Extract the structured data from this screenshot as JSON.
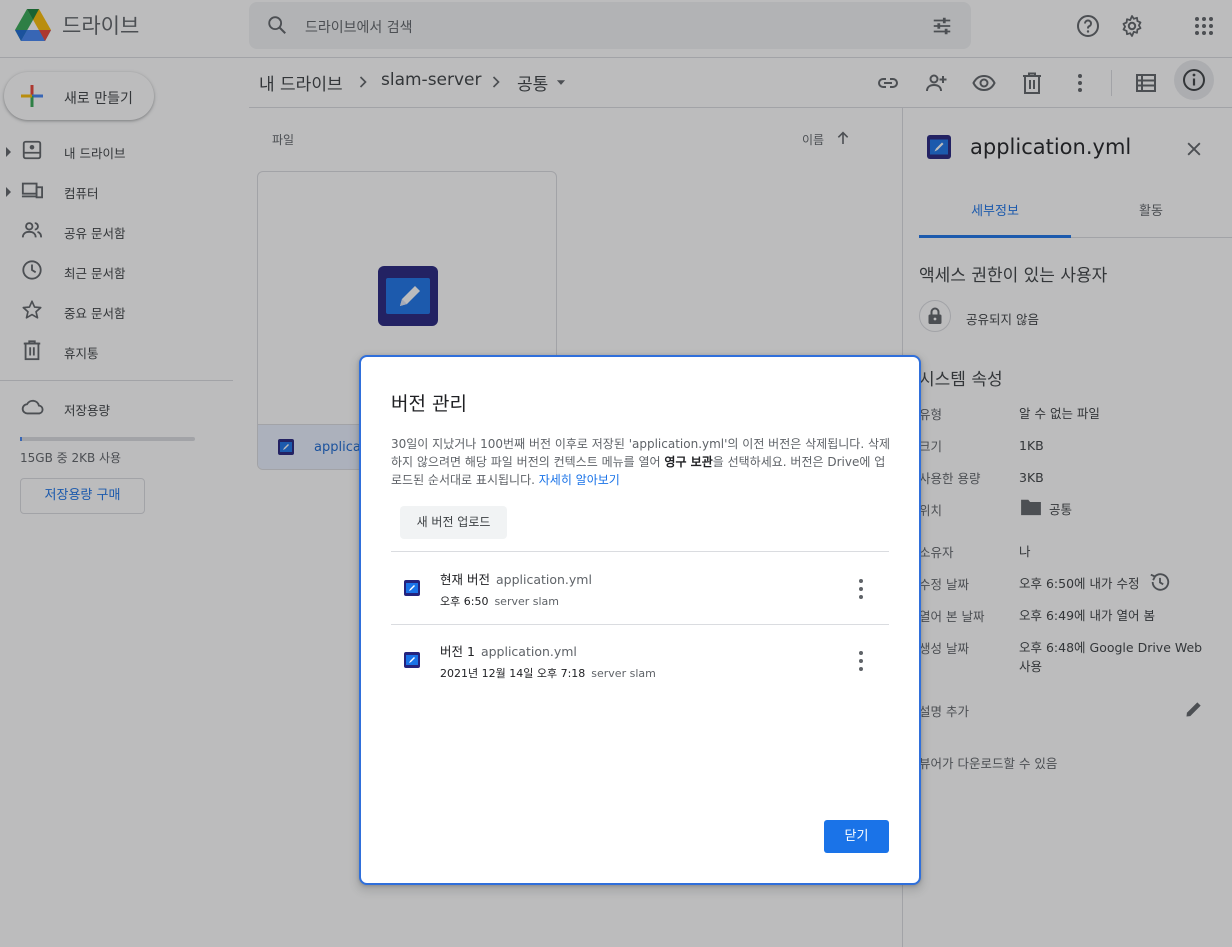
{
  "app": {
    "title": "드라이브"
  },
  "search": {
    "placeholder": "드라이브에서 검색"
  },
  "sidebar": {
    "new_label": "새로 만들기",
    "items": [
      {
        "label": "내 드라이브",
        "icon": "my-drive-icon"
      },
      {
        "label": "컴퓨터",
        "icon": "computers-icon"
      },
      {
        "label": "공유 문서함",
        "icon": "shared-icon"
      },
      {
        "label": "최근 문서함",
        "icon": "recent-icon"
      },
      {
        "label": "중요 문서함",
        "icon": "star-icon"
      },
      {
        "label": "휴지통",
        "icon": "trash-icon"
      }
    ],
    "storage_label": "저장용량",
    "storage_used_fraction": 0.0,
    "storage_text": "15GB 중 2KB 사용",
    "buy_label": "저장용량 구매"
  },
  "breadcrumb": {
    "root": "내 드라이브",
    "folder": "slam-server",
    "current": "공통"
  },
  "main": {
    "files_label": "파일",
    "sort_label": "이름",
    "file_card": {
      "name": "applicat"
    }
  },
  "details": {
    "file_title": "application.yml",
    "tabs": [
      "세부정보",
      "활동"
    ],
    "access_heading": "액세스 권한이 있는 사용자",
    "access_status": "공유되지 않음",
    "system_heading": "시스템 속성",
    "props": [
      {
        "key": "유형",
        "value": "알 수 없는 파일"
      },
      {
        "key": "크기",
        "value": "1KB"
      },
      {
        "key": "사용한 용량",
        "value": "3KB"
      },
      {
        "key": "위치",
        "value": "공통"
      },
      {
        "key": "소유자",
        "value": "나"
      },
      {
        "key": "수정 날짜",
        "value": "오후 6:50에 내가 수정"
      },
      {
        "key": "열어 본 날짜",
        "value": "오후 6:49에 내가 열어 봄"
      },
      {
        "key": "생성 날짜",
        "value": "오후 6:48에 Google Drive Web 사용"
      }
    ],
    "desc_label": "설명 추가",
    "download_note": "뷰어가 다운로드할 수 있음"
  },
  "dialog": {
    "title": "버전 관리",
    "body_1": "30일이 지났거나 100번째 버전 이후로 저장된 'application.yml'의 이전 버전은 삭제됩니다. 삭제하지 않으려면 해당 파일 버전의 컨텍스트 메뉴를 열어 ",
    "body_bold": "영구 보관",
    "body_2": "을 선택하세요. 버전은 Drive에 업로드된 순서대로 표시됩니다. ",
    "body_link": "자세히 알아보기",
    "upload_label": "새 버전 업로드",
    "versions": [
      {
        "title": "현재 버전",
        "name": "application.yml",
        "date": "오후 6:50",
        "user": "server slam"
      },
      {
        "title": "버전 1",
        "name": "application.yml",
        "date": "2021년 12월 14일 오후 7:18",
        "user": "server slam"
      }
    ],
    "close_label": "닫기"
  },
  "colors": {
    "accent": "#1a73e8",
    "file_icon": "#1a4fb5"
  }
}
